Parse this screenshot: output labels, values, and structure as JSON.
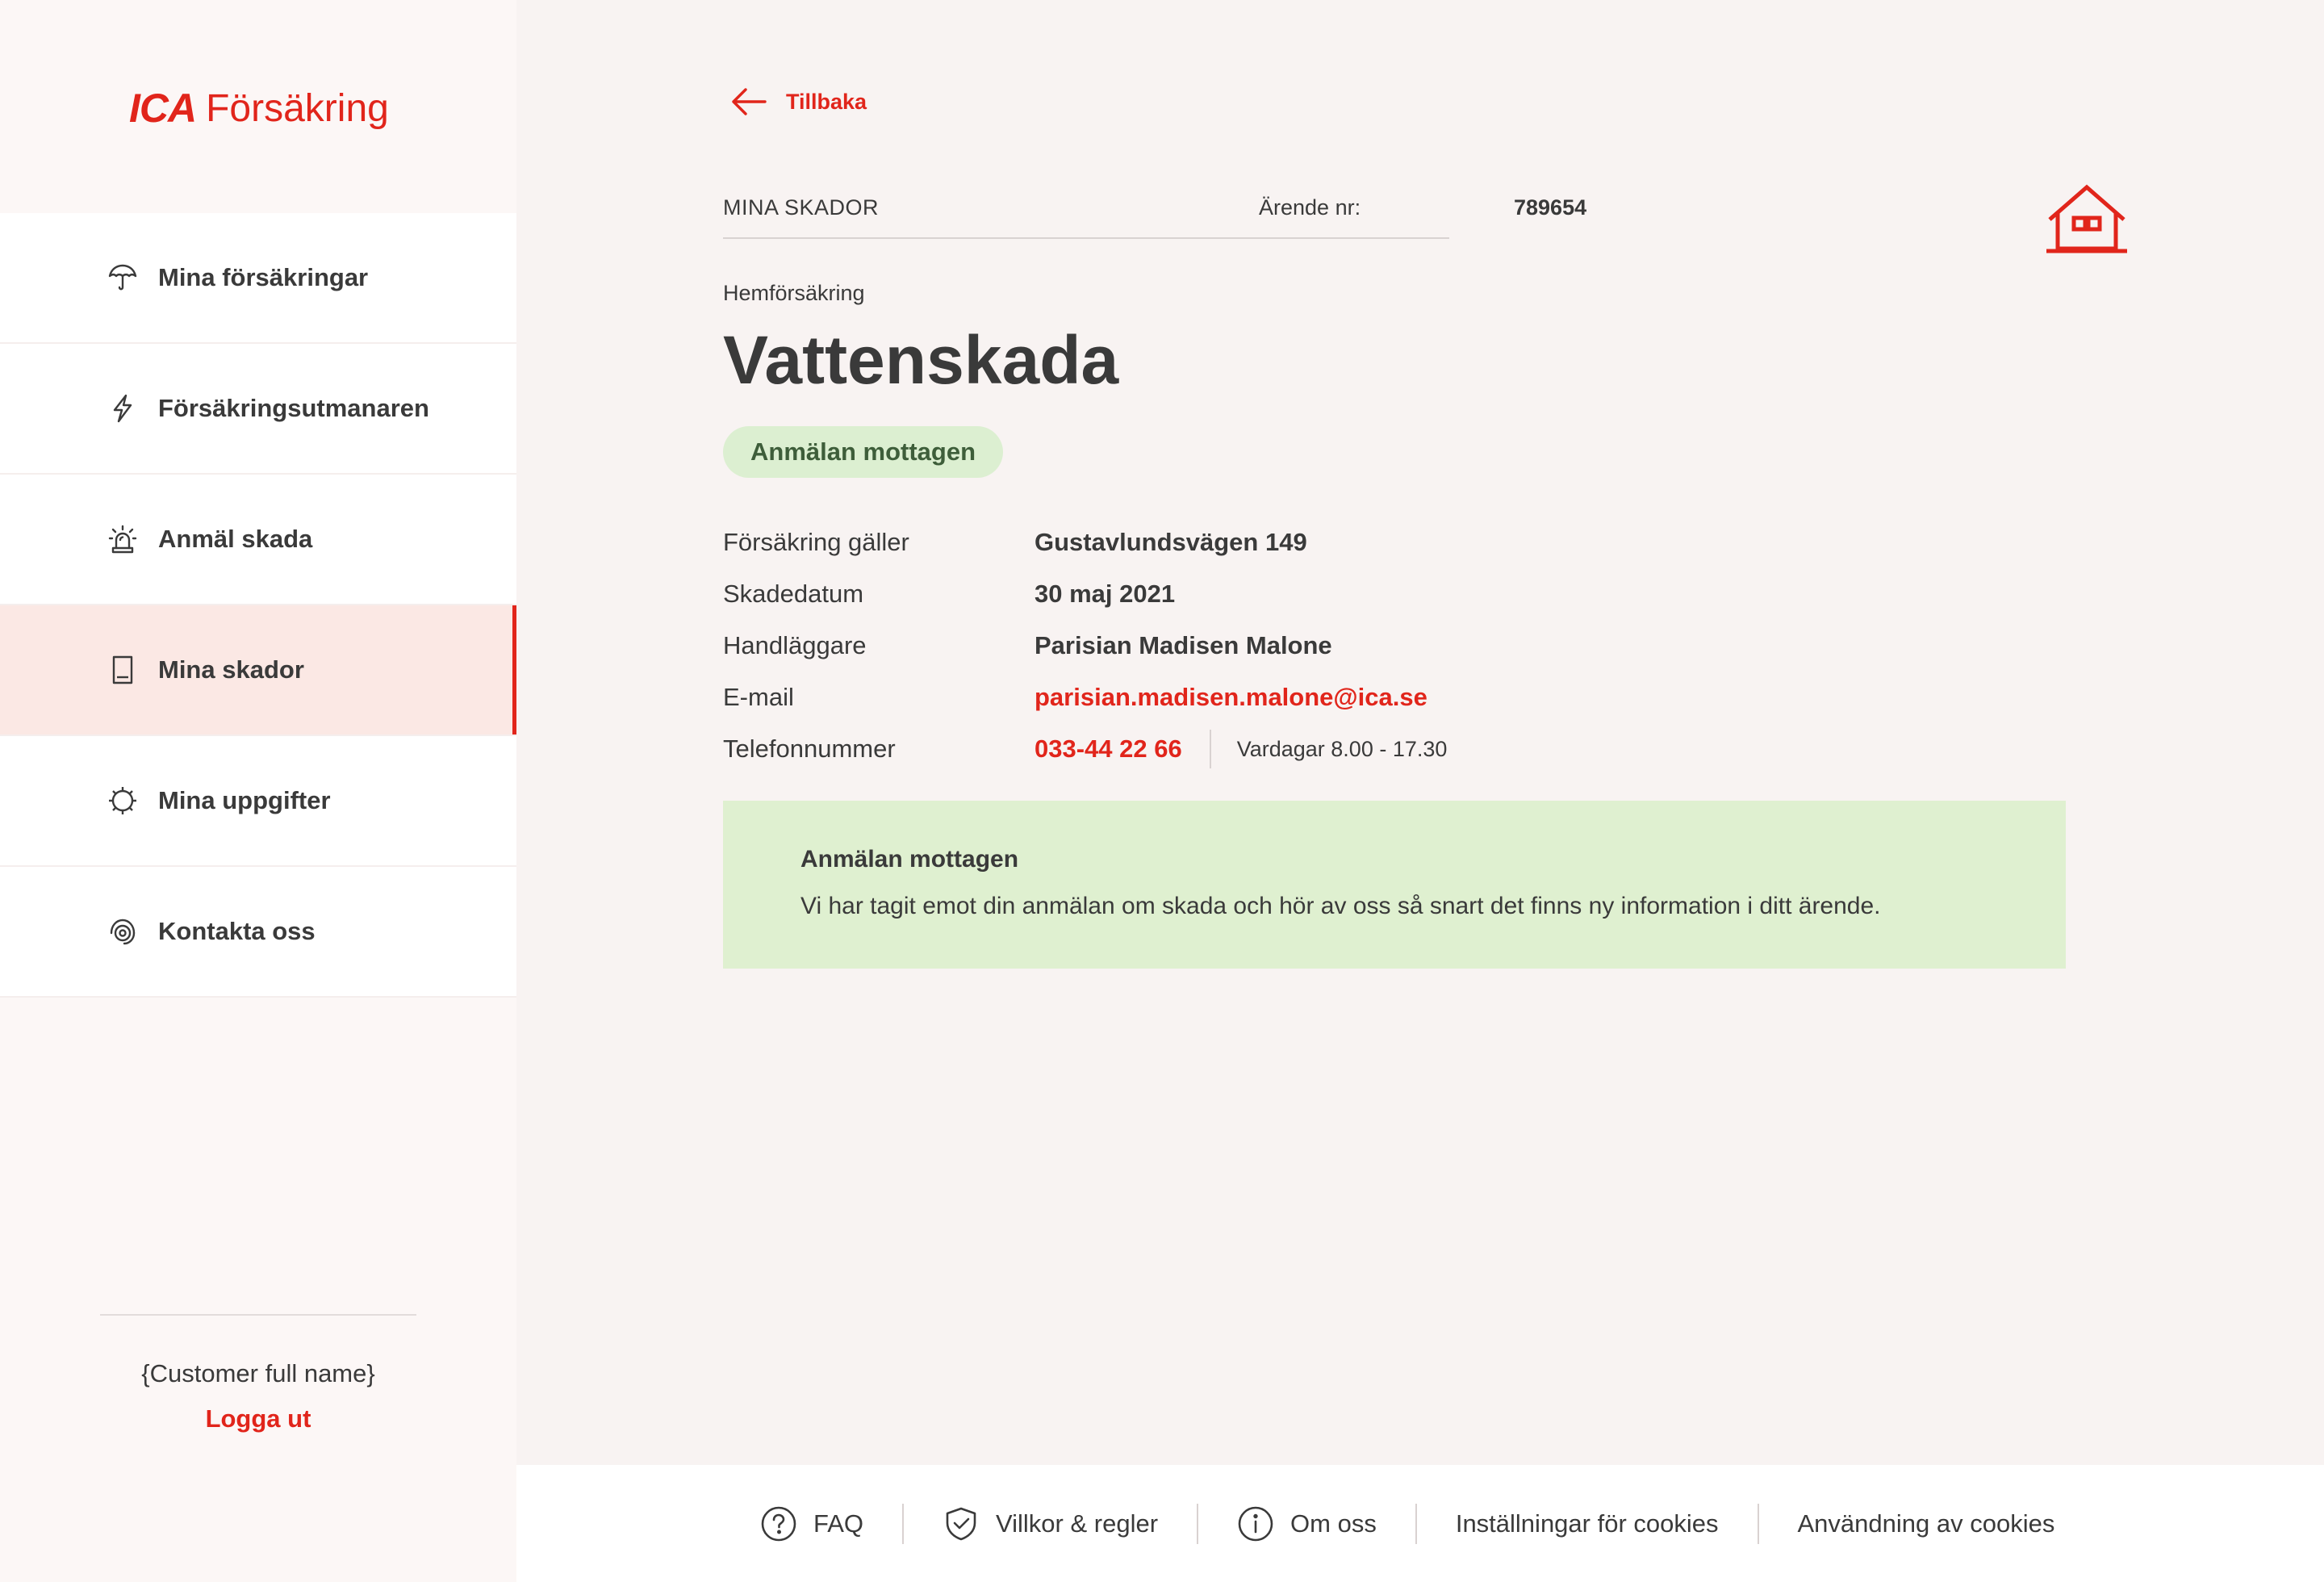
{
  "brand": {
    "logo_mark": "ICA",
    "logo_text": "Försäkring",
    "accent_color": "#e1251b"
  },
  "sidebar": {
    "items": [
      {
        "label": "Mina försäkringar",
        "icon": "umbrella-icon",
        "active": false
      },
      {
        "label": "Försäkringsutmanaren",
        "icon": "lightning-icon",
        "active": false
      },
      {
        "label": "Anmäl skada",
        "icon": "siren-icon",
        "active": false
      },
      {
        "label": "Mina skador",
        "icon": "document-icon",
        "active": true
      },
      {
        "label": "Mina uppgifter",
        "icon": "gear-icon",
        "active": false
      },
      {
        "label": "Kontakta oss",
        "icon": "headset-icon",
        "active": false
      }
    ],
    "customer_name": "{Customer full name}",
    "logout_label": "Logga ut"
  },
  "main": {
    "back_label": "Tillbaka",
    "breadcrumb": "MINA SKADOR",
    "case_label": "Ärende nr:",
    "case_number": "789654",
    "category": "Hemförsäkring",
    "title": "Vattenskada",
    "status": "Anmälan mottagen",
    "status_color": "#dcefd1",
    "details": {
      "policy_label": "Försäkring gäller",
      "policy_value": "Gustavlundsvägen 149",
      "damage_date_label": "Skadedatum",
      "damage_date_value": "30 maj 2021",
      "handler_label": "Handläggare",
      "handler_value": "Parisian Madisen Malone",
      "email_label": "E-mail",
      "email_value": "parisian.madisen.malone@ica.se",
      "phone_label": "Telefonnummer",
      "phone_value": "033-44 22 66",
      "phone_hours": "Vardagar 8.00 - 17.30"
    },
    "info_box": {
      "title": "Anmälan mottagen",
      "text": "Vi har tagit emot din anmälan om skada och hör av oss så snart det finns ny information i ditt ärende."
    }
  },
  "footer": {
    "faq": "FAQ",
    "terms": "Villkor & regler",
    "about": "Om oss",
    "cookie_settings": "Inställningar för cookies",
    "cookie_usage": "Användning av cookies"
  }
}
